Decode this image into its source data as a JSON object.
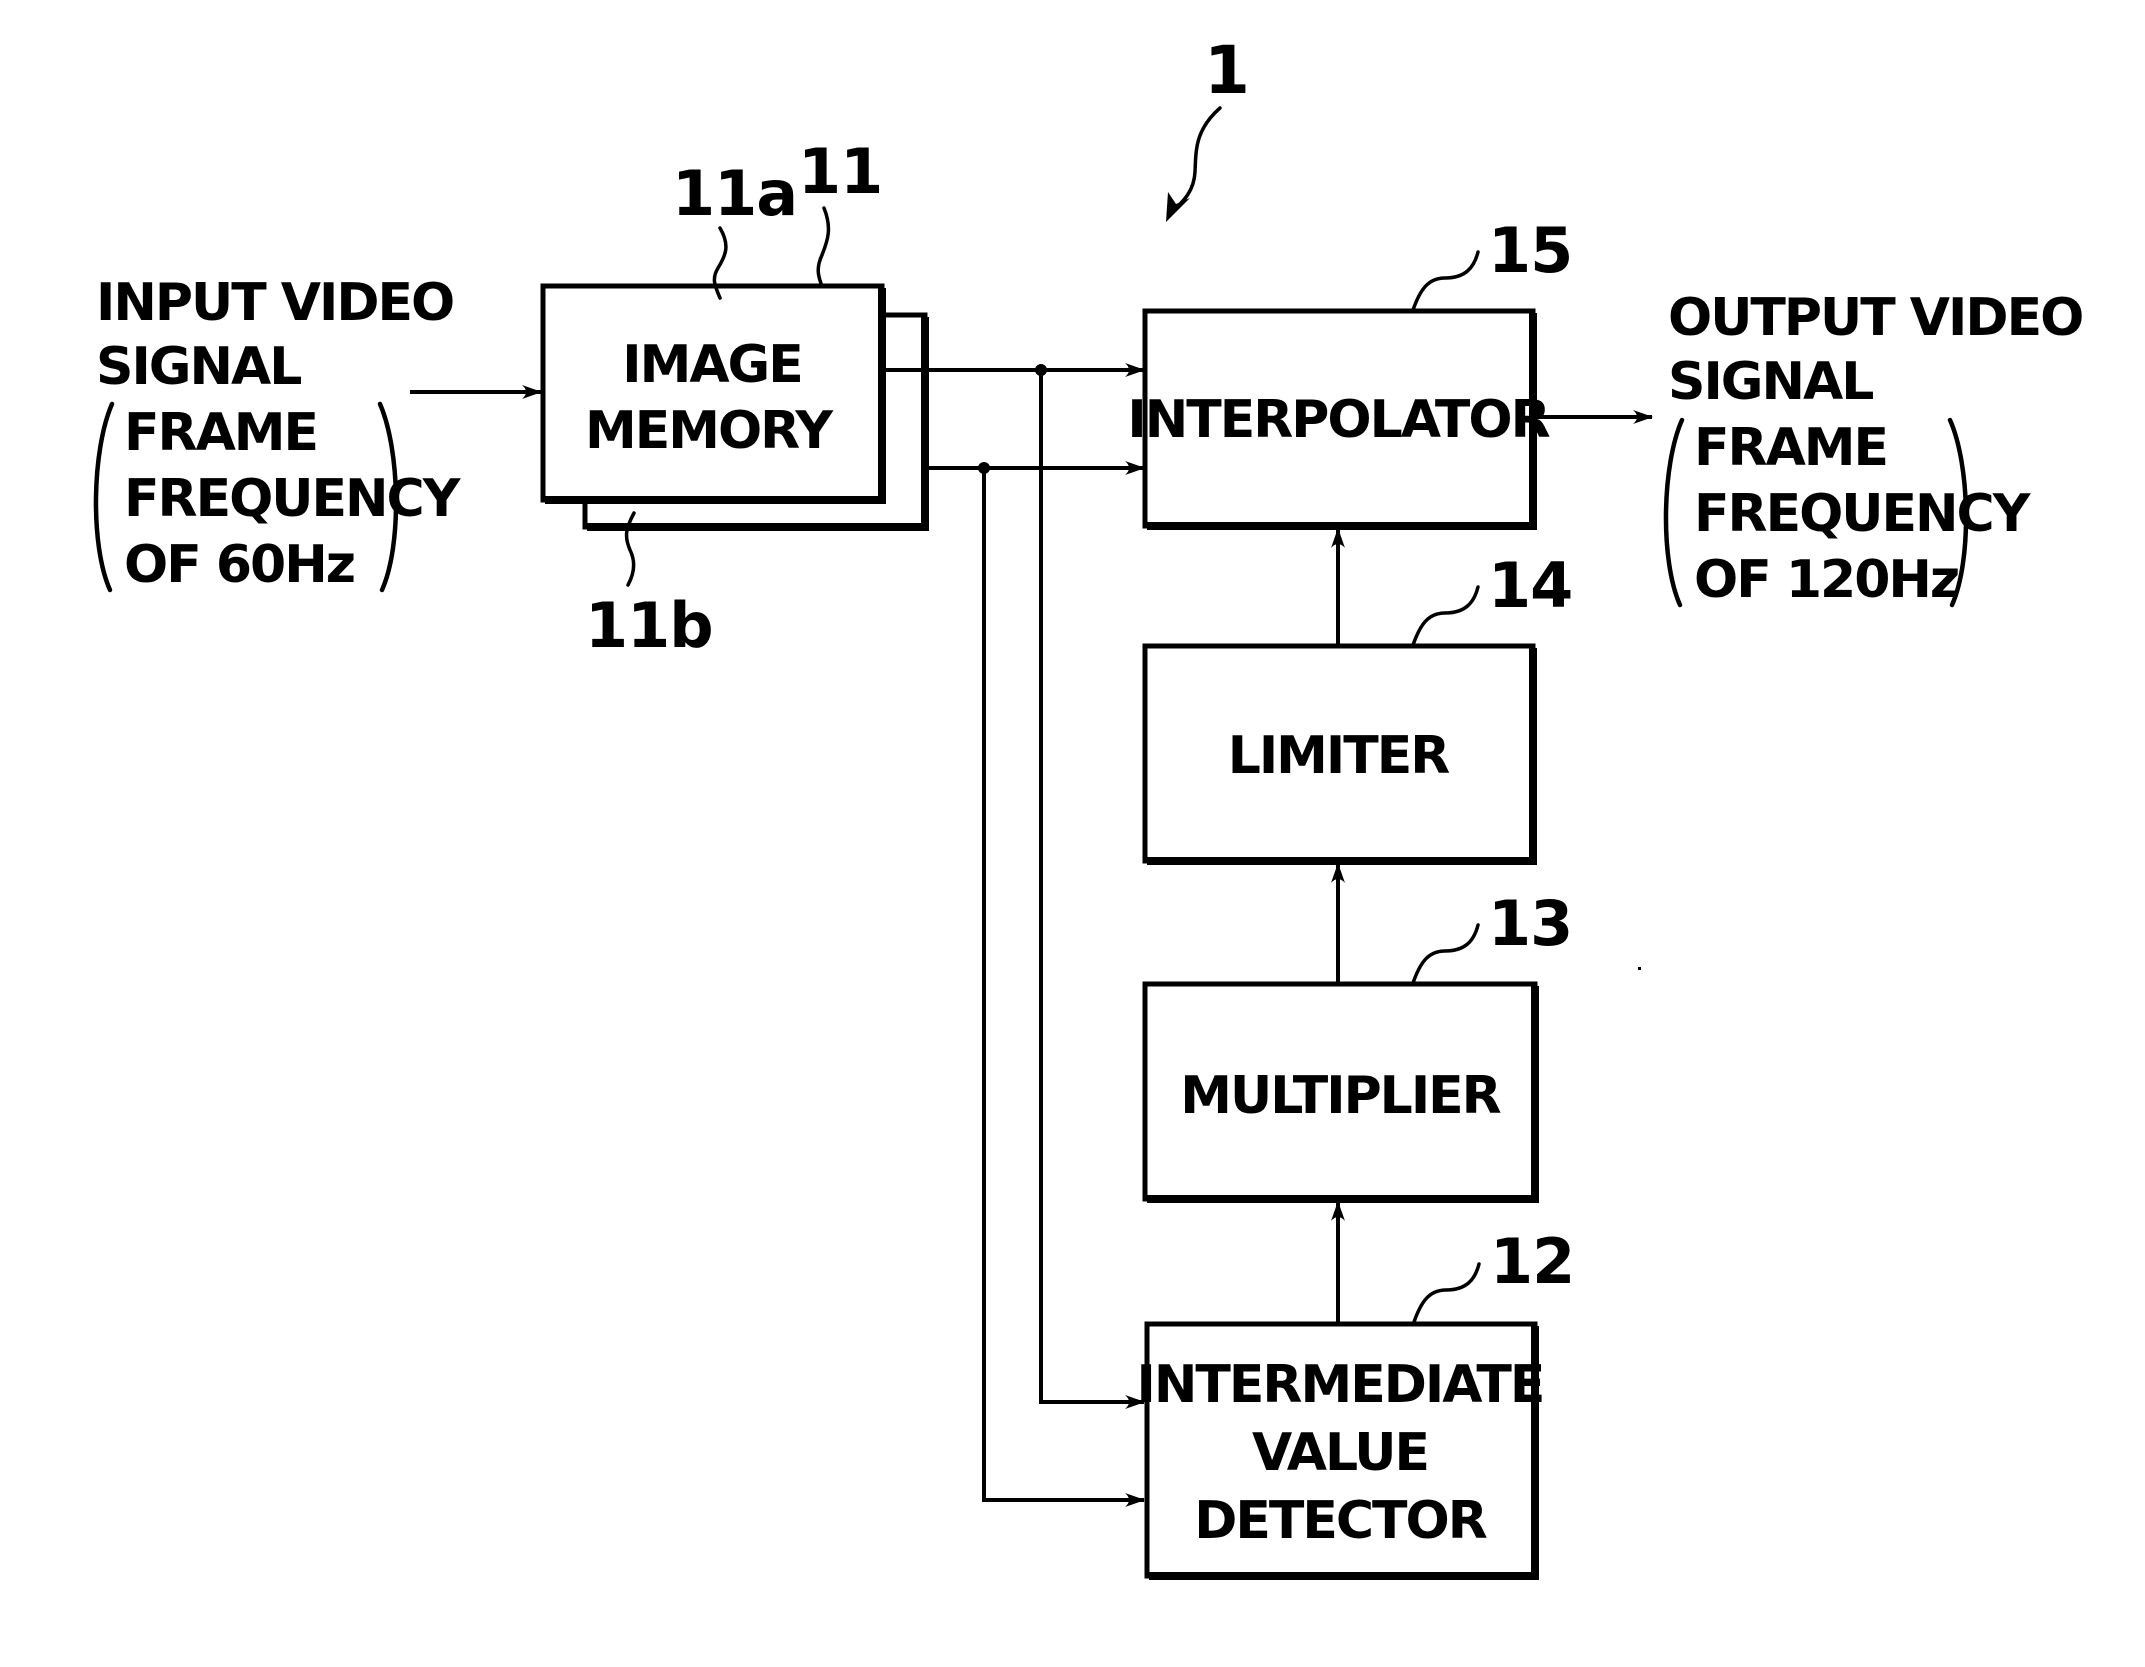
{
  "figure": {
    "reference_numeral": "1",
    "colors": {
      "ink": "#000000",
      "paper": "#ffffff"
    }
  },
  "input_signal": {
    "lines": [
      "INPUT VIDEO",
      "SIGNAL"
    ],
    "bracketed_lines": [
      "FRAME",
      "FREQUENCY",
      "OF 60Hz"
    ]
  },
  "output_signal": {
    "lines": [
      "OUTPUT VIDEO",
      "SIGNAL"
    ],
    "bracketed_lines": [
      "FRAME",
      "FREQUENCY",
      "OF 120Hz"
    ]
  },
  "blocks": {
    "image_memory": {
      "ref": "11",
      "ref_front": "11a",
      "ref_back": "11b",
      "lines": [
        "IMAGE",
        "MEMORY"
      ]
    },
    "interpolator": {
      "ref": "15",
      "lines": [
        "INTERPOLATOR"
      ]
    },
    "limiter": {
      "ref": "14",
      "lines": [
        "LIMITER"
      ]
    },
    "multiplier": {
      "ref": "13",
      "lines": [
        "MULTIPLIER"
      ]
    },
    "intermediate_value_detector": {
      "ref": "12",
      "lines": [
        "INTERMEDIATE",
        "VALUE",
        "DETECTOR"
      ]
    }
  },
  "connections": [
    {
      "from": "input_signal",
      "to": "image_memory"
    },
    {
      "from": "image_memory.11a",
      "to": "interpolator"
    },
    {
      "from": "image_memory.11b",
      "to": "interpolator"
    },
    {
      "from": "image_memory.11a",
      "to": "intermediate_value_detector"
    },
    {
      "from": "image_memory.11b",
      "to": "intermediate_value_detector"
    },
    {
      "from": "intermediate_value_detector",
      "to": "multiplier"
    },
    {
      "from": "multiplier",
      "to": "limiter"
    },
    {
      "from": "limiter",
      "to": "interpolator"
    },
    {
      "from": "interpolator",
      "to": "output_signal"
    }
  ]
}
